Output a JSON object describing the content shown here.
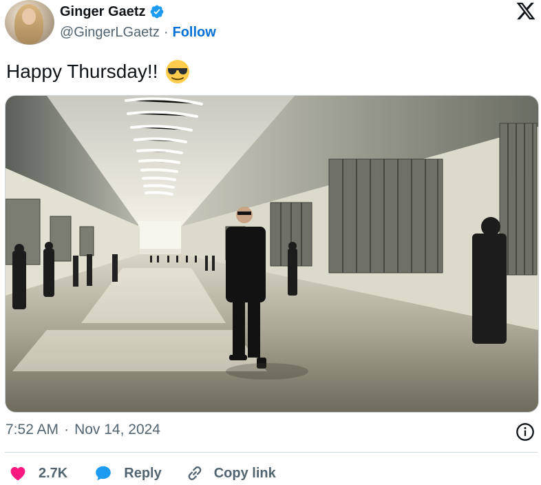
{
  "author": {
    "name": "Ginger Gaetz",
    "handle": "@GingerLGaetz",
    "separator": "·",
    "follow_label": "Follow",
    "verified": true,
    "verified_color": "#1d9bf0"
  },
  "tweet": {
    "text": "Happy Thursday!!",
    "emoji": "smiling-face-with-sunglasses",
    "image_alt": "Man in black suit standing in a long prison corridor with guards and cell blocks"
  },
  "meta": {
    "time": "7:52 AM",
    "separator": "·",
    "date": "Nov 14, 2024"
  },
  "actions": {
    "like_count": "2.7K",
    "reply_label": "Reply",
    "copy_label": "Copy link",
    "like_color": "#f91880",
    "reply_color": "#1d9bf0"
  },
  "icons": {
    "brand": "x-logo",
    "info": "info-icon",
    "like": "heart-icon",
    "reply": "speech-bubble-icon",
    "copy": "link-icon"
  }
}
